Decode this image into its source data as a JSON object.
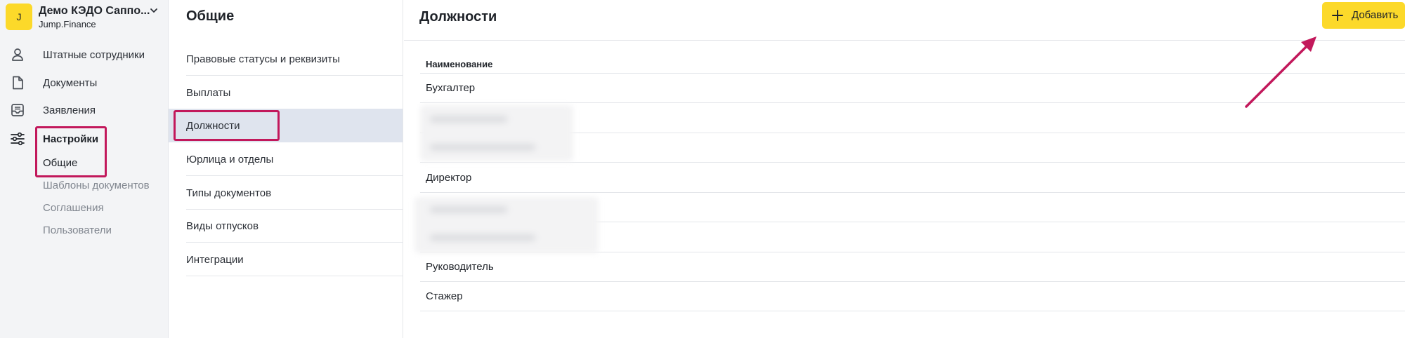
{
  "org": {
    "avatar_letter": "J",
    "name": "Демо КЭДО Саппо...",
    "subtitle": "Jump.Finance"
  },
  "sidebar": {
    "items": [
      {
        "label": "Штатные сотрудники",
        "icon": "person-icon"
      },
      {
        "label": "Документы",
        "icon": "document-icon"
      },
      {
        "label": "Заявления",
        "icon": "inbox-icon"
      },
      {
        "label": "Настройки",
        "icon": "sliders-icon"
      }
    ],
    "settings_subitems": [
      {
        "label": "Общие",
        "active": true
      },
      {
        "label": "Шаблоны документов",
        "active": false
      },
      {
        "label": "Соглашения",
        "active": false
      },
      {
        "label": "Пользователи",
        "active": false
      }
    ]
  },
  "settings": {
    "title": "Общие",
    "items": [
      {
        "label": "Правовые статусы и реквизиты"
      },
      {
        "label": "Выплаты"
      },
      {
        "label": "Должности",
        "active": true
      },
      {
        "label": "Юрлица и отделы"
      },
      {
        "label": "Типы документов"
      },
      {
        "label": "Виды отпусков"
      },
      {
        "label": "Интеграции"
      }
    ]
  },
  "main": {
    "title": "Должности",
    "add_button_label": "Добавить",
    "table": {
      "column_header": "Наименование",
      "rows": [
        "Бухгалтер",
        "",
        "",
        "Директор",
        "",
        "",
        "Руководитель",
        "Стажер"
      ]
    }
  },
  "colors": {
    "accent": "#fcd92a",
    "annotation": "#c2185b",
    "active_row": "#dfe4ee",
    "sidebar_bg": "#f3f4f6"
  }
}
